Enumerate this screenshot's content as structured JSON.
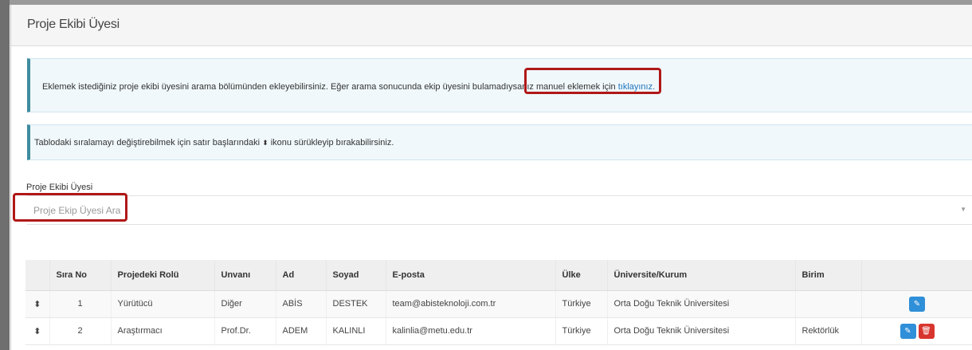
{
  "panel": {
    "title": "Proje Ekibi Üyesi"
  },
  "alerts": {
    "info_text": "Eklemek istediğiniz proje ekibi üyesini arama bölümünden ekleyebilirsiniz. Eğer arama sonucunda ekip üyesini bulamadıysanız manuel eklemek için ",
    "info_link": "tıklayınız.",
    "sort_text_before": "Tablodaki sıralamayı değiştirebilmek için satır başlarındaki ",
    "sort_glyph": "⬍",
    "sort_text_after": " ikonu sürükleyip bırakabilirsiniz."
  },
  "search": {
    "label": "Proje Ekibi Üyesi",
    "placeholder": "Proje Ekip Üyesi Ara"
  },
  "table": {
    "headers": {
      "sira_no": "Sıra No",
      "rol": "Projedeki Rolü",
      "unvan": "Unvanı",
      "ad": "Ad",
      "soyad": "Soyad",
      "eposta": "E-posta",
      "ulke": "Ülke",
      "kurum": "Üniversite/Kurum",
      "birim": "Birim"
    },
    "rows": [
      {
        "sira_no": "1",
        "rol": "Yürütücü",
        "unvan": "Diğer",
        "ad": "ABİS",
        "soyad": "DESTEK",
        "eposta": "team@abisteknoloji.com.tr",
        "ulke": "Türkiye",
        "kurum": "Orta Doğu Teknik Üniversitesi",
        "birim": ""
      },
      {
        "sira_no": "2",
        "rol": "Araştırmacı",
        "unvan": "Prof.Dr.",
        "ad": "ADEM",
        "soyad": "KALINLI",
        "eposta": "kalinlia@metu.edu.tr",
        "ulke": "Türkiye",
        "kurum": "Orta Doğu Teknik Üniversitesi",
        "birim": "Rektörlük"
      }
    ]
  },
  "icons": {
    "drag_handle": "⬍",
    "edit": "✎",
    "delete": "🗑",
    "caret": "▼"
  },
  "colors": {
    "alert_border": "#3f8c9f",
    "highlight": "#b01818",
    "link": "#1e73be",
    "edit_button": "#2f8fd8",
    "delete_button": "#d9352f"
  }
}
